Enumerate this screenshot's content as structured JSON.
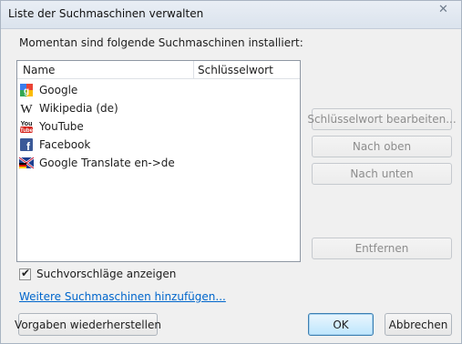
{
  "window": {
    "title": "Liste der Suchmaschinen verwalten"
  },
  "intro": "Momentan sind folgende Suchmaschinen installiert:",
  "table": {
    "columns": [
      "Name",
      "Schlüsselwort"
    ],
    "rows": [
      {
        "name": "Google",
        "keyword": "",
        "icon": "google-icon"
      },
      {
        "name": "Wikipedia (de)",
        "keyword": "",
        "icon": "wikipedia-icon"
      },
      {
        "name": "YouTube",
        "keyword": "",
        "icon": "youtube-icon"
      },
      {
        "name": "Facebook",
        "keyword": "",
        "icon": "facebook-icon"
      },
      {
        "name": "Google Translate en->de",
        "keyword": "",
        "icon": "flag-de-icon"
      }
    ]
  },
  "buttons": {
    "edit_keyword": "Schlüsselwort bearbeiten...",
    "move_up": "Nach oben",
    "move_down": "Nach unten",
    "remove": "Entfernen",
    "restore_defaults": "Vorgaben wiederherstellen",
    "ok": "OK",
    "cancel": "Abbrechen"
  },
  "suggestions": {
    "label": "Suchvorschläge anzeigen",
    "checked": true
  },
  "more_link": "Weitere Suchmaschinen hinzufügen...",
  "colors": {
    "link": "#0066cc",
    "default_button_border": "#3c7fb1"
  }
}
